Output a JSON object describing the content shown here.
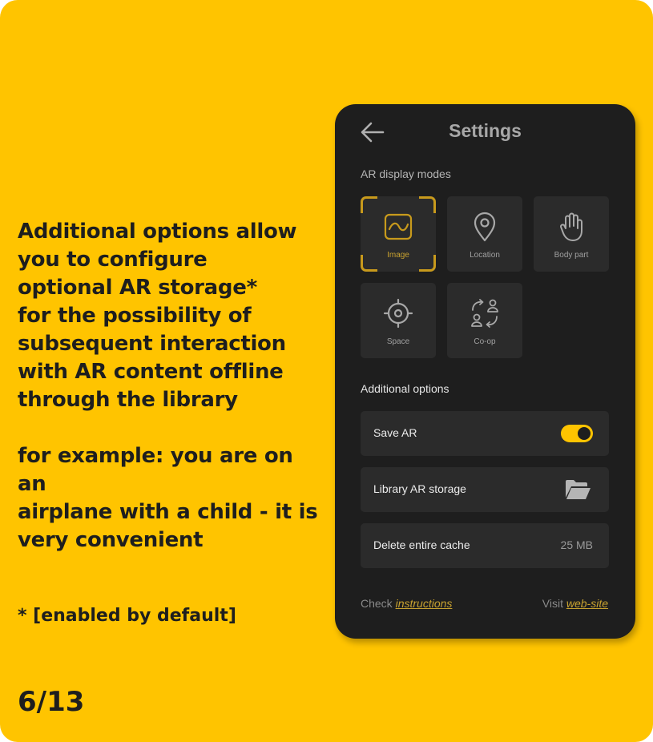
{
  "slide": {
    "paragraph_lines": [
      "Additional options allow",
      "you to configure",
      "optional AR storage*",
      "for the possibility of",
      "subsequent interaction",
      "with AR content offline",
      "through the library"
    ],
    "example_lines": [
      "for example: you are on an",
      "airplane with a child - it is",
      "very convenient"
    ],
    "footnote": "* [enabled by default]",
    "page_number": "6/13",
    "background_color": "#FFC400"
  },
  "phone": {
    "title": "Settings",
    "back_icon": "arrow-left-icon",
    "display_modes_label": "AR display modes",
    "modes": [
      {
        "label": "Image",
        "icon": "image-icon",
        "selected": true
      },
      {
        "label": "Location",
        "icon": "location-pin-icon",
        "selected": false
      },
      {
        "label": "Body part",
        "icon": "hand-icon",
        "selected": false
      },
      {
        "label": "Space",
        "icon": "target-icon",
        "selected": false
      },
      {
        "label": "Co-op",
        "icon": "users-sync-icon",
        "selected": false
      }
    ],
    "additional_label": "Additional options",
    "options": {
      "save_ar": {
        "label": "Save AR",
        "enabled": true
      },
      "library": {
        "label": "Library AR storage",
        "icon": "folder-open-icon"
      },
      "cache": {
        "label": "Delete entire cache",
        "value": "25 MB"
      }
    },
    "footer": {
      "check_text": "Check",
      "check_link": "instructions",
      "visit_text": "Visit",
      "visit_link": "web-site"
    },
    "accent_color": "#C89A1C"
  }
}
